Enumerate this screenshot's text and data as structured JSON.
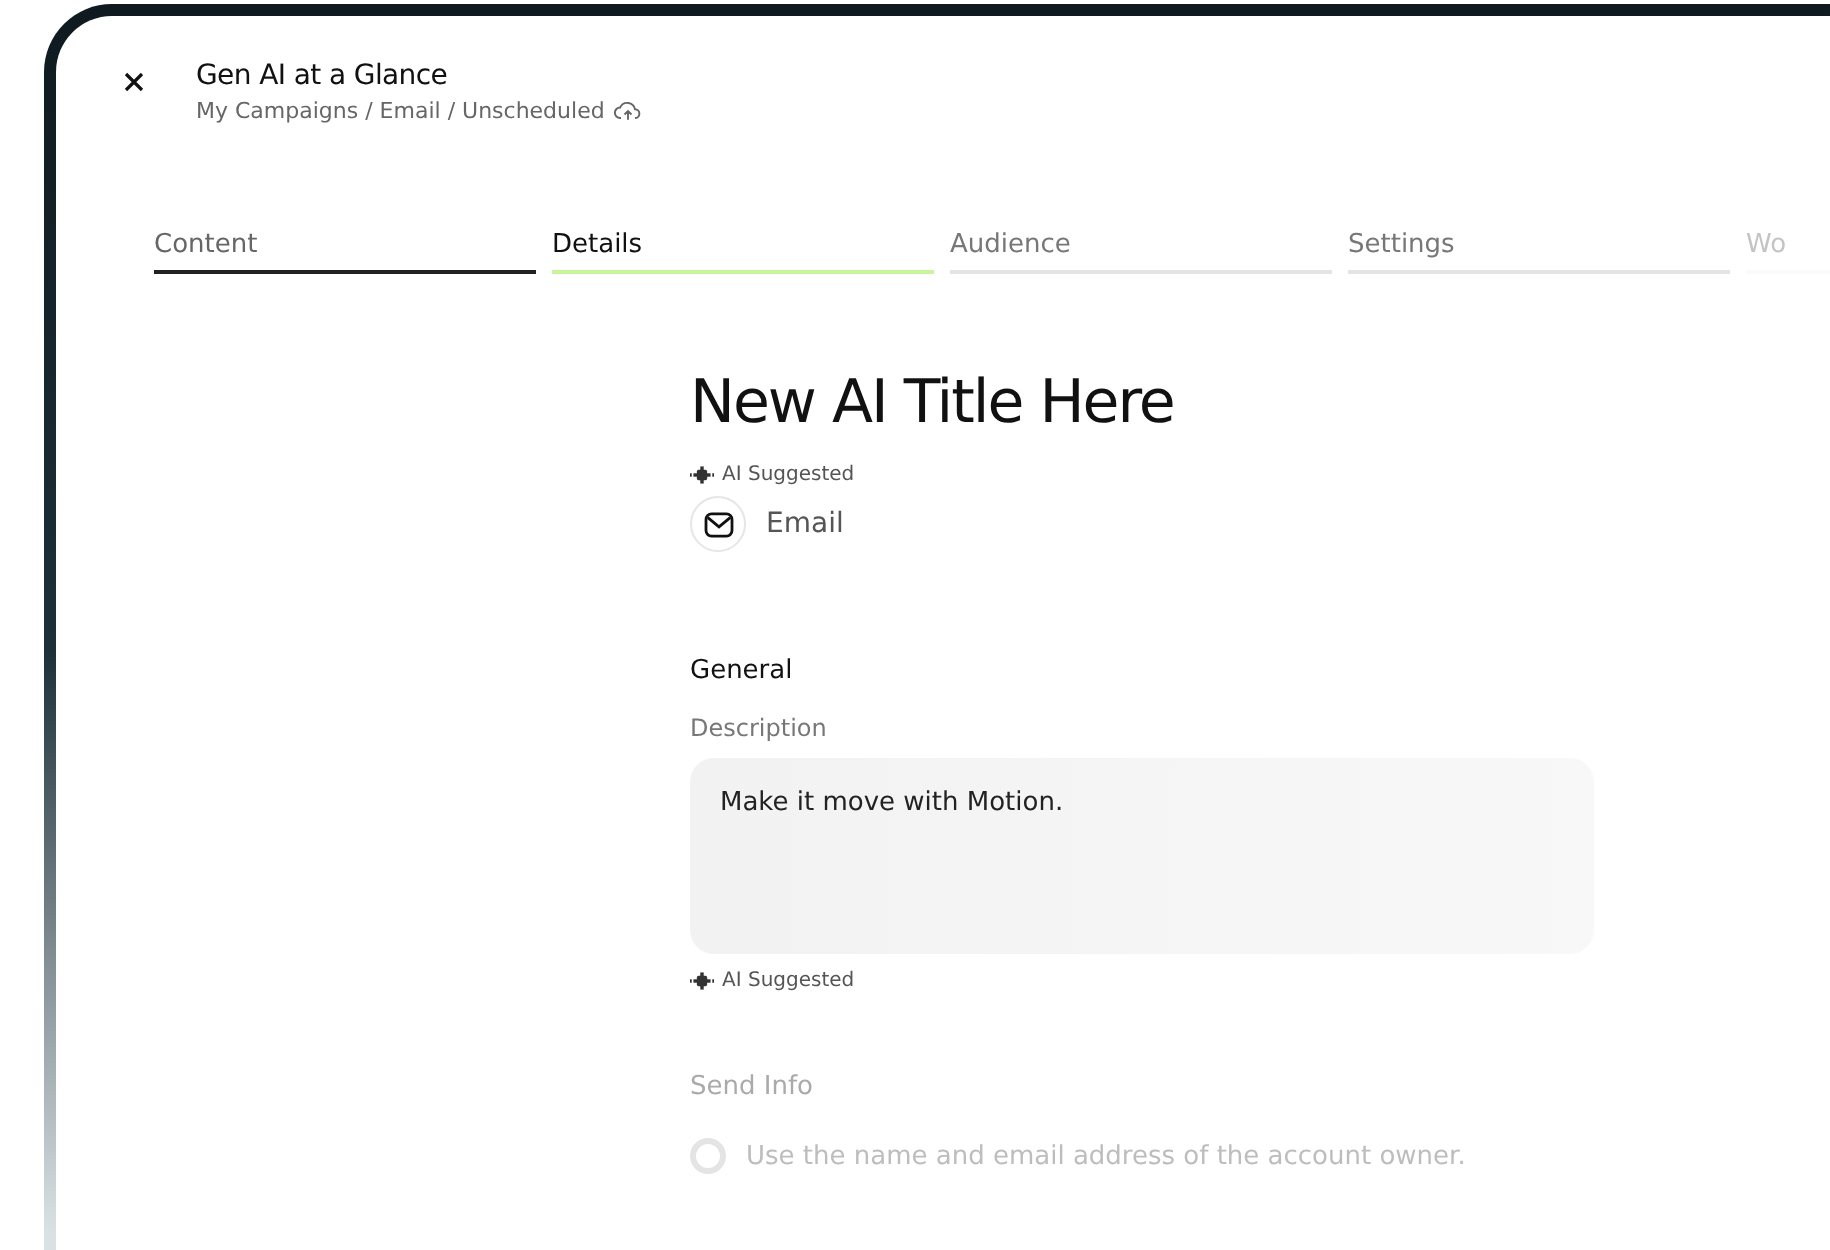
{
  "header": {
    "title": "Gen AI at a Glance",
    "breadcrumb": "My Campaigns / Email / Unscheduled"
  },
  "tabs": [
    {
      "label": "Content",
      "selected": false,
      "completed": true,
      "faded": false
    },
    {
      "label": "Details",
      "selected": true,
      "completed": false,
      "faded": false
    },
    {
      "label": "Audience",
      "selected": false,
      "completed": false,
      "faded": false
    },
    {
      "label": "Settings",
      "selected": false,
      "completed": false,
      "faded": false
    },
    {
      "label": "Wo",
      "selected": false,
      "completed": false,
      "faded": true
    }
  ],
  "campaign": {
    "title": "New AI Title Here",
    "ai_note": "AI Suggested",
    "channel": "Email"
  },
  "general": {
    "heading": "General",
    "description_label": "Description",
    "description_value": "Make it move with Motion.",
    "ai_note": "AI Suggested"
  },
  "send_info": {
    "heading": "Send Info",
    "disabled": true,
    "options": [
      {
        "label": "Use the name and email address of the account owner.",
        "selected": false
      }
    ]
  }
}
